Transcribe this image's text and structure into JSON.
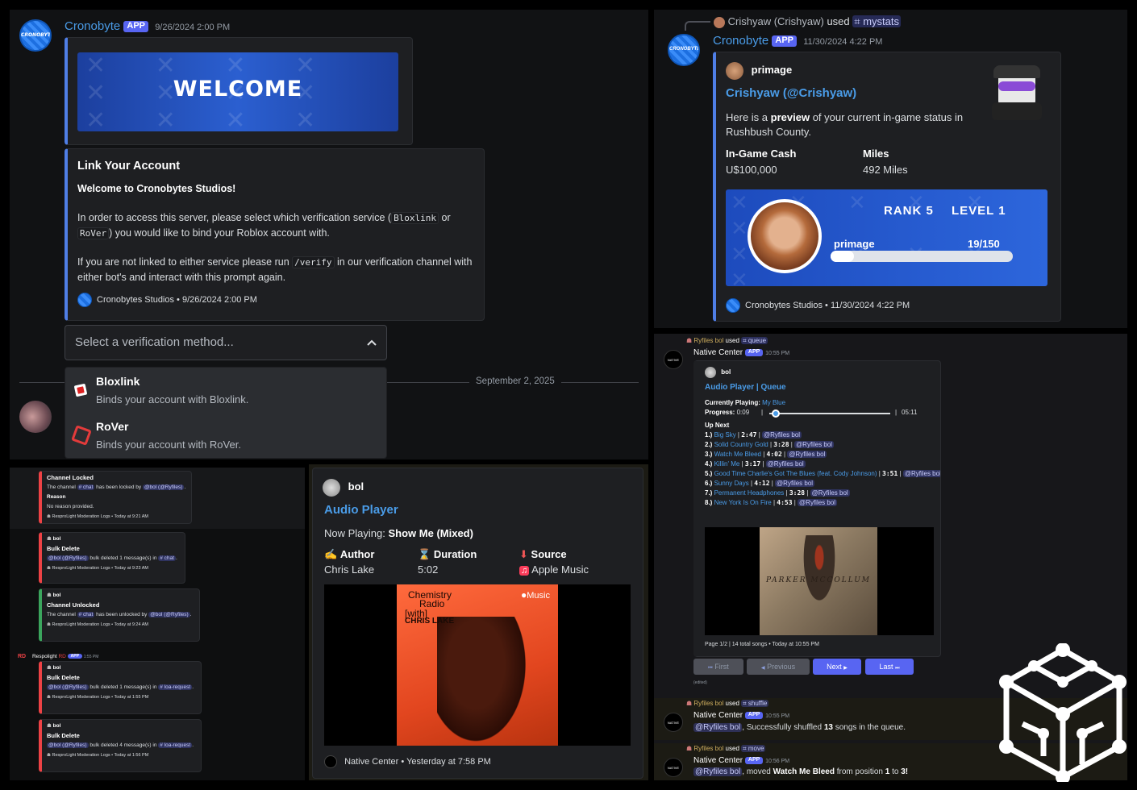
{
  "colors": {
    "accent": "#4f7ee6",
    "blurple": "#5865f2",
    "link": "#4a9ce8",
    "bg": "#111214",
    "embed": "#1e1f22",
    "danger": "#ed4245"
  },
  "top_left": {
    "bot_name": "Cronobyte",
    "app_badge": "APP",
    "timestamp": "9/26/2024 2:00 PM",
    "avatar_text": "CRONOBYTES",
    "banner_text": "WELCOME",
    "embed": {
      "title": "Link Your Account",
      "subtitle": "Welcome to Cronobytes Studios!",
      "p1_a": "In order to access this server, please select which verification service (",
      "p1_code1": "Bloxlink",
      "p1_b": "or",
      "p1_code2": "RoVer",
      "p1_c": ") you would like to bind your Roblox account with.",
      "p2_a": "If you are not linked to either service please run",
      "p2_code": "/verify",
      "p2_b": "in our verification channel with either bot's and interact with this prompt again.",
      "footer": "Cronobytes Studios • 9/26/2024 2:00 PM"
    },
    "select": {
      "placeholder": "Select a verification method...",
      "chevron": "chevron-up-icon"
    },
    "divider_date": "September 2, 2025",
    "options": [
      {
        "label": "Bloxlink",
        "desc": "Binds your account with Bloxlink.",
        "icon": "bloxlink-icon"
      },
      {
        "label": "RoVer",
        "desc": "Binds your account with RoVer.",
        "icon": "rover-icon"
      }
    ]
  },
  "top_right": {
    "reply_user": "Crishyaw (Crishyaw)",
    "reply_used": "used",
    "reply_command": "mystats",
    "bot_name": "Cronobyte",
    "app_badge": "APP",
    "timestamp": "11/30/2024 4:22 PM",
    "embed": {
      "author": "primage",
      "title": "Crishyaw (@Crishyaw)",
      "desc_a": "Here is a",
      "desc_bold": "preview",
      "desc_b": "of your current in-game status in Rushbush County.",
      "field1_name": "In-Game Cash",
      "field1_value": "U$100,000",
      "field2_name": "Miles",
      "field2_value": "492 Miles",
      "rank_card": {
        "rank": "RANK 5",
        "level": "LEVEL 1",
        "username": "primage",
        "xp": "19/150",
        "progress": 0.13
      },
      "footer": "Cronobytes Studios • 11/30/2024 4:22 PM"
    }
  },
  "bottom_left": {
    "items": [
      {
        "title": "Channel Locked",
        "line_a": "The channel",
        "chan": "# chat",
        "line_b": "has been locked by",
        "user": "@bol (@Ryfiles)",
        "reason_label": "Reason",
        "reason": "No reason provided.",
        "footer": "ResproLight Moderation Logs • Today at 9:21 AM"
      },
      {
        "author": "bol",
        "title": "Bulk Delete",
        "user": "@bol (@Ryfiles)",
        "line": "bulk deleted 1 message(s) in",
        "chan": "# chat",
        "footer": "ResproLight Moderation Logs • Today at 9:23 AM"
      },
      {
        "author": "bol",
        "title": "Channel Unlocked",
        "line_a": "The channel",
        "chan": "# chat",
        "line_b": "has been unlocked by",
        "user": "@bol (@Ryfiles)",
        "footer": "ResproLight Moderation Logs • Today at 9:24 AM"
      },
      {
        "author": "bol",
        "title": "Bulk Delete",
        "user": "@bol (@Ryfiles)",
        "line": "bulk deleted 1 message(s) in",
        "chan": "# loa-request",
        "footer": "ResproLight Moderation Logs • Today at 1:55 PM"
      },
      {
        "author": "bol",
        "title": "Bulk Delete",
        "user": "@bol (@Ryfiles)",
        "line": "bulk deleted 4 message(s) in",
        "chan": "# loa-request",
        "footer": "ResproLight Moderation Logs • Today at 1:56 PM"
      }
    ],
    "respo_name": "Respolight",
    "respo_tag": "RD",
    "respo_badge": "APP",
    "respo_time": "1:55 PM"
  },
  "bottom_middle": {
    "author": "bol",
    "title": "Audio Player",
    "now_label": "Now Playing:",
    "now_song": "Show Me (Mixed)",
    "author_label": "Author",
    "author_value": "Chris Lake",
    "duration_label": "Duration",
    "duration_value": "5:02",
    "source_label": "Source",
    "source_value": "Apple Music",
    "cover": {
      "line1": "Chemistry",
      "line2": "Radio",
      "line3": "[with]",
      "line4": "CHRIS LAKE",
      "brand": "Music"
    },
    "footer": "Native Center • Yesterday at 7:58 PM"
  },
  "bottom_right": {
    "reply_user": "Ryfiles bol",
    "reply_used": "used",
    "reply_command": "queue",
    "bot_name": "Native Center",
    "app_badge": "APP",
    "timestamp": "10:55 PM",
    "embed": {
      "author": "bol",
      "title": "Audio Player | Queue",
      "playing_label": "Currently Playing:",
      "playing_song": "My Blue",
      "progress_label": "Progress:",
      "progress_time": "0:09",
      "progress_total": "05:11",
      "progress": 0.03,
      "upnext": "Up Next",
      "queue": [
        {
          "n": "1.)",
          "song": "Big Sky",
          "dur": "2:47",
          "user": "@Ryfiles bol"
        },
        {
          "n": "2.)",
          "song": "Solid Country Gold",
          "dur": "3:28",
          "user": "@Ryfiles bol"
        },
        {
          "n": "3.)",
          "song": "Watch Me Bleed",
          "dur": "4:02",
          "user": "@Ryfiles bol"
        },
        {
          "n": "4.)",
          "song": "Killin' Me",
          "dur": "3:17",
          "user": "@Ryfiles bol"
        },
        {
          "n": "5.)",
          "song": "Good Time Charlie's Got The Blues (feat. Cody Johnson)",
          "dur": "3:51",
          "user": "@Ryfiles bol"
        },
        {
          "n": "6.)",
          "song": "Sunny Days",
          "dur": "4:12",
          "user": "@Ryfiles bol"
        },
        {
          "n": "7.)",
          "song": "Permanent Headphones",
          "dur": "3:28",
          "user": "@Ryfiles bol"
        },
        {
          "n": "8.)",
          "song": "New York Is On Fire",
          "dur": "4:53",
          "user": "@Ryfiles bol"
        }
      ],
      "cover_text": "PARKER MCCOLLUM",
      "footer": "Page 1/2 | 14 total songs • Today at 10:55 PM"
    },
    "buttons": {
      "first": "First",
      "previous": "Previous",
      "next": "Next",
      "last": "Last"
    },
    "edited": "(edited)",
    "msg2": {
      "reply_user": "Ryfiles bol",
      "reply_used": "used",
      "reply_command": "shuffle",
      "bot_name": "Native Center",
      "app_badge": "APP",
      "timestamp": "10:55 PM",
      "mention": "@Ryfiles bol",
      "text_a": ", Successfully shuffled",
      "count": "13",
      "text_b": "songs in the queue."
    },
    "msg3": {
      "reply_user": "Ryfiles bol",
      "reply_used": "used",
      "reply_command": "move",
      "bot_name": "Native Center",
      "app_badge": "APP",
      "timestamp": "10:56 PM",
      "mention": "@Ryfiles bol",
      "text_a": ", moved",
      "song": "Watch Me Bleed",
      "text_b": "from position",
      "from": "1",
      "text_c": "to",
      "to": "3!"
    }
  }
}
